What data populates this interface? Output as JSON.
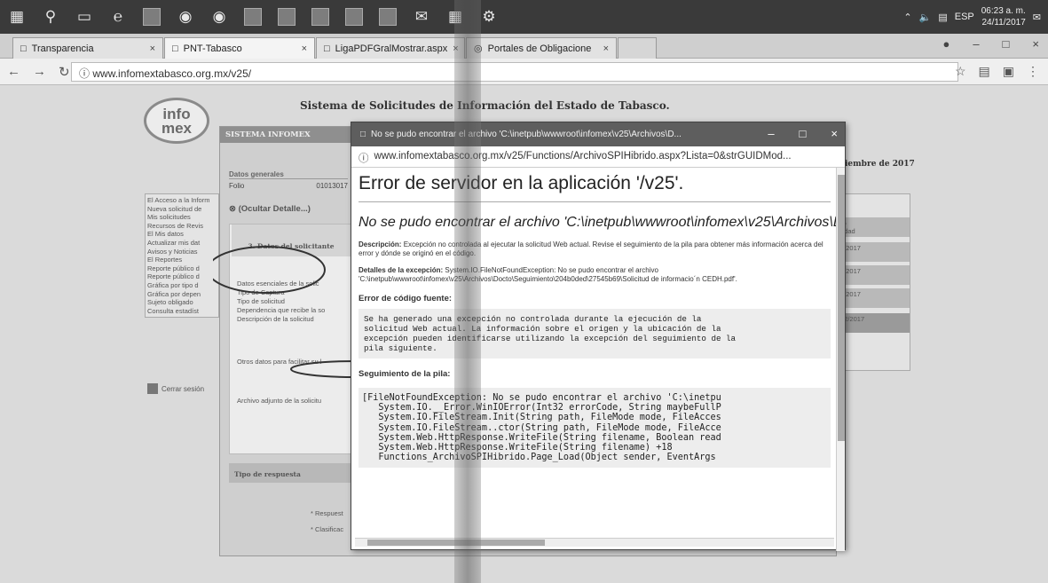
{
  "taskbar": {
    "icons": [
      "windows-icon",
      "search-icon",
      "task-view-icon",
      "edge-icon",
      "store-icon",
      "chrome-icon",
      "app-icon",
      "app-icon",
      "app-icon",
      "app-icon",
      "app-icon",
      "app-icon",
      "mail-icon",
      "excel-icon",
      "settings-icon"
    ],
    "lang": "ESP",
    "time": "06:23 a. m.",
    "date": "24/11/2017"
  },
  "browser": {
    "tabs": [
      {
        "label": "Transparencia"
      },
      {
        "label": "PNT-Tabasco"
      },
      {
        "label": "LigaPDFGralMostrar.aspx"
      },
      {
        "label": "Portales de Obligacione"
      }
    ],
    "url": "www.infomextabasco.org.mx/v25/"
  },
  "site": {
    "logo_top": "info",
    "logo_bottom": "mex",
    "title": "Sistema de Solicitudes de Información del Estado de Tabasco.",
    "month": "iembre de 2017",
    "nav_items": [
      "El Acceso a la Inform",
      "Nueva solicitud de",
      "Mis solicitudes",
      "Recursos de Revis",
      "El Mis datos",
      "Actualizar mis dat",
      "Avisos y Noticias",
      "El Reportes",
      "Reporte público d",
      "Reporte público d",
      "Gráfica por tipo d",
      "Gráfica por depen",
      "Sujeto obligado",
      "Consulta estadíst"
    ],
    "logout": "Cerrar sesión",
    "panel_title": "SISTEMA INFOMEX",
    "datos_generales": "Datos generales",
    "folio_label": "Folio",
    "folio": "01013017",
    "ocultar": "(Ocultar Detalle...)",
    "form_header": "3. Datos del solicitante",
    "form_labels": [
      "Datos esenciales de la solic",
      "Tipo de Captura",
      "Tipo de solicitud",
      "Dependencia que recibe la so",
      "Descripción de la solicitud",
      "Otros datos para facilitar su l",
      "Archivo adjunto de la solicitu"
    ],
    "tipo_respuesta": "Tipo de respuesta",
    "respuesta": "* Respuest",
    "clasificacion": "* Clasificac",
    "right_col": [
      "ro",
      "udad",
      "2/2017",
      "9",
      "2/2017",
      "9",
      "2/2017",
      "9",
      "12/2017",
      "9"
    ]
  },
  "popup": {
    "title": "No se pudo encontrar el archivo 'C:\\inetpub\\wwwroot\\infomex\\v25\\Archivos\\D...",
    "url": "www.infomextabasco.org.mx/v25/Functions/ArchivoSPIHibrido.aspx?Lista=0&strGUIDMod...",
    "error_title": "Error de servidor en la aplicación '/v25'.",
    "error_subtitle": "No se pudo encontrar el archivo 'C:\\inetpub\\wwwroot\\infomex\\v25\\Archivos\\Docto\\Seguimiei de informacio´n CEDH.pdf'.",
    "desc_label": "Descripción:",
    "desc_text": " Excepción no controlada al ejecutar la solicitud Web actual. Revise el seguimiento de la pila para obtener más información acerca del error y dónde se originó en el código.",
    "exc_label": "Detalles de la excepción:",
    "exc_text": " System.IO.FileNotFoundException: No se pudo encontrar el archivo 'C:\\inetpub\\wwwroot\\infomex\\v25\\Archivos\\Docto\\Seguimiento\\204b0ded\\27545b69\\Solicitud de informacio´n CEDH.pdf'.",
    "source_error_label": "Error de código fuente:",
    "source_error_text": "Se ha generado una excepción no controlada durante la ejecución de la\nsolicitud Web actual. La información sobre el origen y la ubicación de la\nexcepción pueden identificarse utilizando la excepción del seguimiento de la\npila siguiente.",
    "stack_label": "Seguimiento de la pila:",
    "stack_text": "[FileNotFoundException: No se pudo encontrar el archivo 'C:\\inetpu\n   System.IO.__Error.WinIOError(Int32 errorCode, String maybeFullP\n   System.IO.FileStream.Init(String path, FileMode mode, FileAcces\n   System.IO.FileStream..ctor(String path, FileMode mode, FileAcce\n   System.Web.HttpResponse.WriteFile(String filename, Boolean read\n   System.Web.HttpResponse.WriteFile(String filename) +18\n   Functions_ArchivoSPIHibrido.Page_Load(Object sender, EventArgs"
  }
}
